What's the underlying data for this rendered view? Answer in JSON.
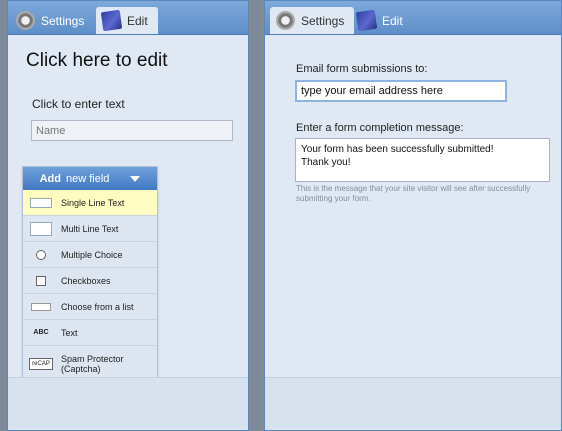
{
  "left_panel": {
    "tabs": [
      {
        "label": "Settings",
        "icon": "gear-icon"
      },
      {
        "label": "Edit",
        "icon": "pencil-icon"
      }
    ],
    "title": "Click here to edit",
    "text_label": "Click to enter text",
    "name_placeholder": "Name",
    "add_field": {
      "label_bold": "Add",
      "label_rest": "new field",
      "items": [
        {
          "label": "Single Line Text",
          "icon": "single-line-text-icon"
        },
        {
          "label": "Multi Line Text",
          "icon": "multi-line-text-icon"
        },
        {
          "label": "Multiple Choice",
          "icon": "radio-icon"
        },
        {
          "label": "Checkboxes",
          "icon": "checkbox-icon"
        },
        {
          "label": "Choose from a list",
          "icon": "dropdown-icon"
        },
        {
          "label": "Text",
          "icon": "text-icon"
        },
        {
          "label": "Spam Protector (Captcha)",
          "icon": "captcha-icon"
        }
      ]
    }
  },
  "right_panel": {
    "tabs": [
      {
        "label": "Settings",
        "icon": "gear-icon"
      },
      {
        "label": "Edit",
        "icon": "pencil-icon"
      }
    ],
    "email_label": "Email form submissions to:",
    "email_value": "type your email address here",
    "completion_label": "Enter a form completion message:",
    "completion_line1": "Your form has been successfully submitted!",
    "completion_line2": "Thank you!",
    "helper_text": "This is the message that your site visitor will see after successfully submitting your form."
  },
  "colors": {
    "tab_blue": "#6f9ed8",
    "panel_bg": "#dfe8f3",
    "highlight": "#fefcc1"
  }
}
